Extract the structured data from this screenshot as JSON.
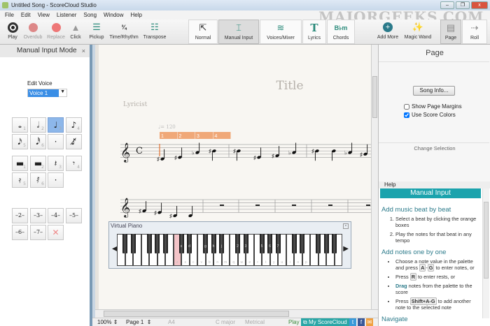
{
  "window": {
    "title": "Untitled Song - ScoreCloud Studio",
    "minimize": "–",
    "restore": "❐",
    "close": "x",
    "watermark": "MAJORGEEKS.COM"
  },
  "menu": [
    "File",
    "Edit",
    "View",
    "Listener",
    "Song",
    "Window",
    "Help"
  ],
  "toolbar": {
    "play": "Play",
    "overdub": "Overdub",
    "replace": "Replace",
    "click": "Click",
    "pickup": "Pickup",
    "time_rhythm": "Time/Rhythm",
    "transpose": "Transpose",
    "normal": "Normal",
    "manual_input": "Manual Input",
    "voices_mixer": "Voices/Mixer",
    "lyrics": "Lyrics",
    "chords": "Chords",
    "chords_icon": "B♭m",
    "lyrics_icon": "T",
    "add_more": "Add More",
    "magic_wand": "Magic Wand",
    "page": "Page",
    "roll": "Roll"
  },
  "left_panel": {
    "title": "Manual Input Mode",
    "close": "×",
    "edit_voice_label": "Edit Voice",
    "voice_value": "Voice 1",
    "notes": [
      {
        "g": "𝅝",
        "n": "1"
      },
      {
        "g": "𝅗𝅥",
        "n": "2"
      },
      {
        "g": "♩",
        "n": "3",
        "selected": true
      },
      {
        "g": "♪",
        "n": "4"
      },
      {
        "g": "𝅘𝅥𝅯",
        "n": "5"
      },
      {
        "g": "𝅘𝅥𝅰",
        "n": "6"
      },
      {
        "g": "·",
        "n": ""
      },
      {
        "g": "♪̸",
        "n": ""
      }
    ],
    "rests": [
      {
        "g": "▬",
        "n": "1"
      },
      {
        "g": "▬",
        "n": "2"
      },
      {
        "g": "𝄽",
        "n": "3"
      },
      {
        "g": "𝄾",
        "n": "4"
      },
      {
        "g": "𝄿",
        "n": "5"
      },
      {
        "g": "𝅀",
        "n": "6"
      },
      {
        "g": "·",
        "n": ""
      }
    ],
    "tuplets": [
      "–2–",
      "–3–",
      "–4–",
      "–5–",
      "–6–",
      "–7–"
    ]
  },
  "score": {
    "title": "Title",
    "lyricist": "Lyricist",
    "tempo": "♩= 120",
    "time_signature": "C",
    "beats": [
      "1",
      "2",
      "3",
      "4"
    ],
    "staff1_notes": [
      {
        "s": -1,
        "a": "♯"
      },
      {
        "s": 0,
        "a": "♯"
      },
      {
        "s": 3,
        "a": "♭"
      },
      {
        "s": 4,
        "a": "♯"
      },
      {
        "s": 4,
        "a": "♯"
      },
      {
        "s": 0,
        "a": "♯"
      },
      {
        "s": 1,
        "a": "♯"
      },
      {
        "s": 3,
        "a": "♭"
      },
      {
        "s": 4,
        "a": "♯"
      },
      {
        "s": 4,
        "a": ""
      },
      {
        "s": 3,
        "a": "♭"
      },
      {
        "s": 2,
        "a": "♯"
      }
    ],
    "staff2_notes": [
      {
        "s": 1,
        "a": "♯"
      },
      {
        "s": 0,
        "a": "♯"
      },
      {
        "s": -2,
        "a": "♯"
      },
      {
        "s": -2,
        "a": ""
      }
    ]
  },
  "piano": {
    "title": "Virtual Piano",
    "white_labels": [
      "z",
      "x",
      "c",
      "v",
      "b",
      "n",
      "m",
      "q",
      "w",
      "e",
      "r",
      "t",
      "y",
      "u",
      "i",
      "o",
      "p"
    ],
    "black_labels": [
      "s",
      "d",
      "g",
      "h",
      "j",
      "2",
      "3",
      "5",
      "6",
      "7",
      "9",
      "0"
    ],
    "highlighted_key": "C"
  },
  "status": {
    "zoom": "100%",
    "page": "Page 1",
    "paper": "A4",
    "key": "C major",
    "meter": "Metrical",
    "play": "Play",
    "myscorecloud": "My ScoreCloud"
  },
  "right_panel": {
    "title": "Page",
    "song_info": "Song Info...",
    "show_margins": "Show Page Margins",
    "show_margins_checked": false,
    "use_colors": "Use Score Colors",
    "use_colors_checked": true,
    "change_selection": "Change Selection",
    "help_label": "Help",
    "help_title": "Manual Input",
    "h1": "Add music beat by beat",
    "s1": [
      "Select a beat by clicking the orange boxes",
      "Play the notes for that beat in any tempo"
    ],
    "h2": "Add notes one by one",
    "b1a": "Choose a note value in the palette and press",
    "b1k1": "A",
    "b1m": "-",
    "b1k2": "G",
    "b1b": "to enter notes, or",
    "b2a": "Press",
    "b2k": "R",
    "b2b": "to enter rests, or",
    "b3k": "Drag",
    "b3b": "notes from the palette to the score",
    "b4a": "Press",
    "b4k": "Shift+A-G",
    "b4b": "to add another note to the selected note",
    "h3": "Navigate"
  }
}
